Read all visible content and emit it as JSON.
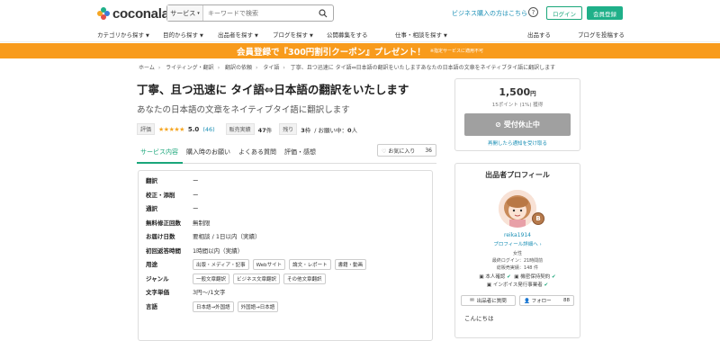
{
  "header": {
    "logo_text": "coconala",
    "search_category": "サービス",
    "search_placeholder": "キーワードで検索",
    "business_link": "ビジネス購入の方はこちら",
    "help_icon": "?",
    "login_label": "ログイン",
    "register_label": "会員登録"
  },
  "nav": {
    "items": [
      "カテゴリから探す",
      "目的から探す",
      "出品者を探す",
      "ブログを探す",
      "公開募集をする",
      "仕事・相談を探す",
      "出品する",
      "ブログを投稿する"
    ]
  },
  "banner": {
    "text": "会員登録で『300円割引クーポン』プレゼント！",
    "note": "※指定サービスに適用不可"
  },
  "breadcrumb": [
    "ホーム",
    "ライティング・翻訳",
    "翻訳の依頼",
    "タイ語",
    "丁寧、且つ迅速に タイ語⇔日本語の翻訳をいたしますあなたの日本語の文章をネイティブタイ語に翻訳します"
  ],
  "service": {
    "title": "丁寧、且つ迅速に タイ語⇔日本語の翻訳をいたします",
    "subtitle": "あなたの日本語の文章をネイティブタイ語に翻訳します",
    "rating_label": "評価",
    "stars": "★★★★★",
    "rating": "5.0",
    "review_count": "(46)",
    "sales_label": "販売実績",
    "sales_count": "47",
    "sales_unit": "件",
    "remaining_label": "残り",
    "remaining_count": "3",
    "remaining_unit": "枠",
    "in_progress": "/ お願い中：",
    "in_progress_count": "0",
    "in_progress_unit": "人"
  },
  "tabs": [
    "サービス内容",
    "購入時のお願い",
    "よくある質問",
    "評価・感想"
  ],
  "favorite": {
    "label": "お気に入り",
    "count": "36"
  },
  "specs": [
    {
      "label": "翻訳",
      "value": "ー"
    },
    {
      "label": "校正・添削",
      "value": "ー"
    },
    {
      "label": "通訳",
      "value": "ー"
    },
    {
      "label": "無料修正回数",
      "value": "無制限"
    },
    {
      "label": "お届け日数",
      "value": "要相談 / 1日以内（実績）"
    },
    {
      "label": "初回返答時間",
      "value": "1時間以内（実績）"
    },
    {
      "label": "用途",
      "chips": [
        "出版・メディア・記事",
        "Webサイト",
        "論文・レポート",
        "書籍・動画"
      ]
    },
    {
      "label": "ジャンル",
      "chips": [
        "一般文章翻訳",
        "ビジネス文章翻訳",
        "その他文章翻訳"
      ]
    },
    {
      "label": "文字単価",
      "value": "3円〜/1文字"
    },
    {
      "label": "言語",
      "chips": [
        "日本語→外国語",
        "外国語→日本語"
      ]
    }
  ],
  "price_card": {
    "price": "1,500",
    "currency": "円",
    "points": "15ポイント (1%) 獲得",
    "closed_label": "受付休止中",
    "notify_link": "再開したら通知を受け取る"
  },
  "profile": {
    "title": "出品者プロフィール",
    "badge": "B",
    "username": "reika1914",
    "detail_link": "プロフィール詳細へ",
    "gender": "女性",
    "last_login": "最終ログイン：21時間前",
    "total_sales": "総販売実績：148 件",
    "verified": "本人確認",
    "nda": "機密保持契約",
    "invoice": "インボイス発行事業者",
    "message_label": "出品者に質問",
    "follow_label": "フォロー",
    "follow_count": "88",
    "greeting": "こんにちは"
  },
  "colors": {
    "brand": "#1aa67a",
    "banner": "#f89b1c",
    "link": "#1a8fb5",
    "star": "#f5a623"
  }
}
